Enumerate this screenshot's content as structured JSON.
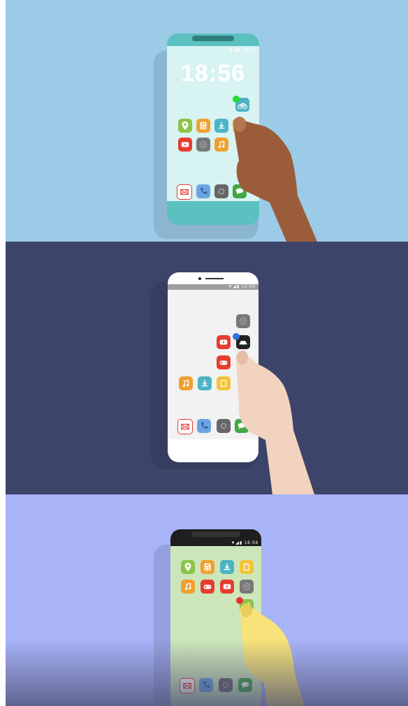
{
  "panel1": {
    "clock": "18:56",
    "status": "▼◢▮ 18:56",
    "colors": {
      "background": "#9ccbe8",
      "phone": "#5bc0c0",
      "screen": "#d7f3f2",
      "hand": "#9b5c3a",
      "touch": "#22dd33"
    },
    "icons": [
      "bike-icon",
      "map-pin-icon",
      "calculator-icon",
      "download-icon",
      "notes-icon",
      "youtube-icon",
      "settings-icon",
      "music-icon",
      "mail-icon",
      "phone-icon",
      "camera-icon",
      "messages-icon"
    ]
  },
  "panel2": {
    "status": "▼◢▮ 12:00",
    "colors": {
      "background": "#3d4469",
      "phone": "#ffffff",
      "screen": "#f2f2f2",
      "hand": "#f1d3c0",
      "touch": "#3a6fe0"
    },
    "icons": [
      "settings-icon",
      "youtube-icon",
      "car-icon",
      "gamepad-icon",
      "music-icon",
      "download-icon",
      "notes-icon",
      "mail-icon",
      "phone-icon",
      "camera-icon",
      "messages-icon"
    ]
  },
  "panel3": {
    "status": "▼◢▮ 18:56",
    "colors": {
      "background": "#a8b3f8",
      "phone": "#1e1e1e",
      "screen": "#cde6b9",
      "hand": "#f7e37a",
      "touch": "#e83030"
    },
    "icons": [
      "map-pin-icon",
      "calculator-icon",
      "download-icon",
      "notes-icon",
      "music-icon",
      "gamepad-icon",
      "youtube-icon",
      "settings-icon",
      "cleaner-icon",
      "mail-icon",
      "phone-icon",
      "camera-icon",
      "messages-icon"
    ]
  }
}
